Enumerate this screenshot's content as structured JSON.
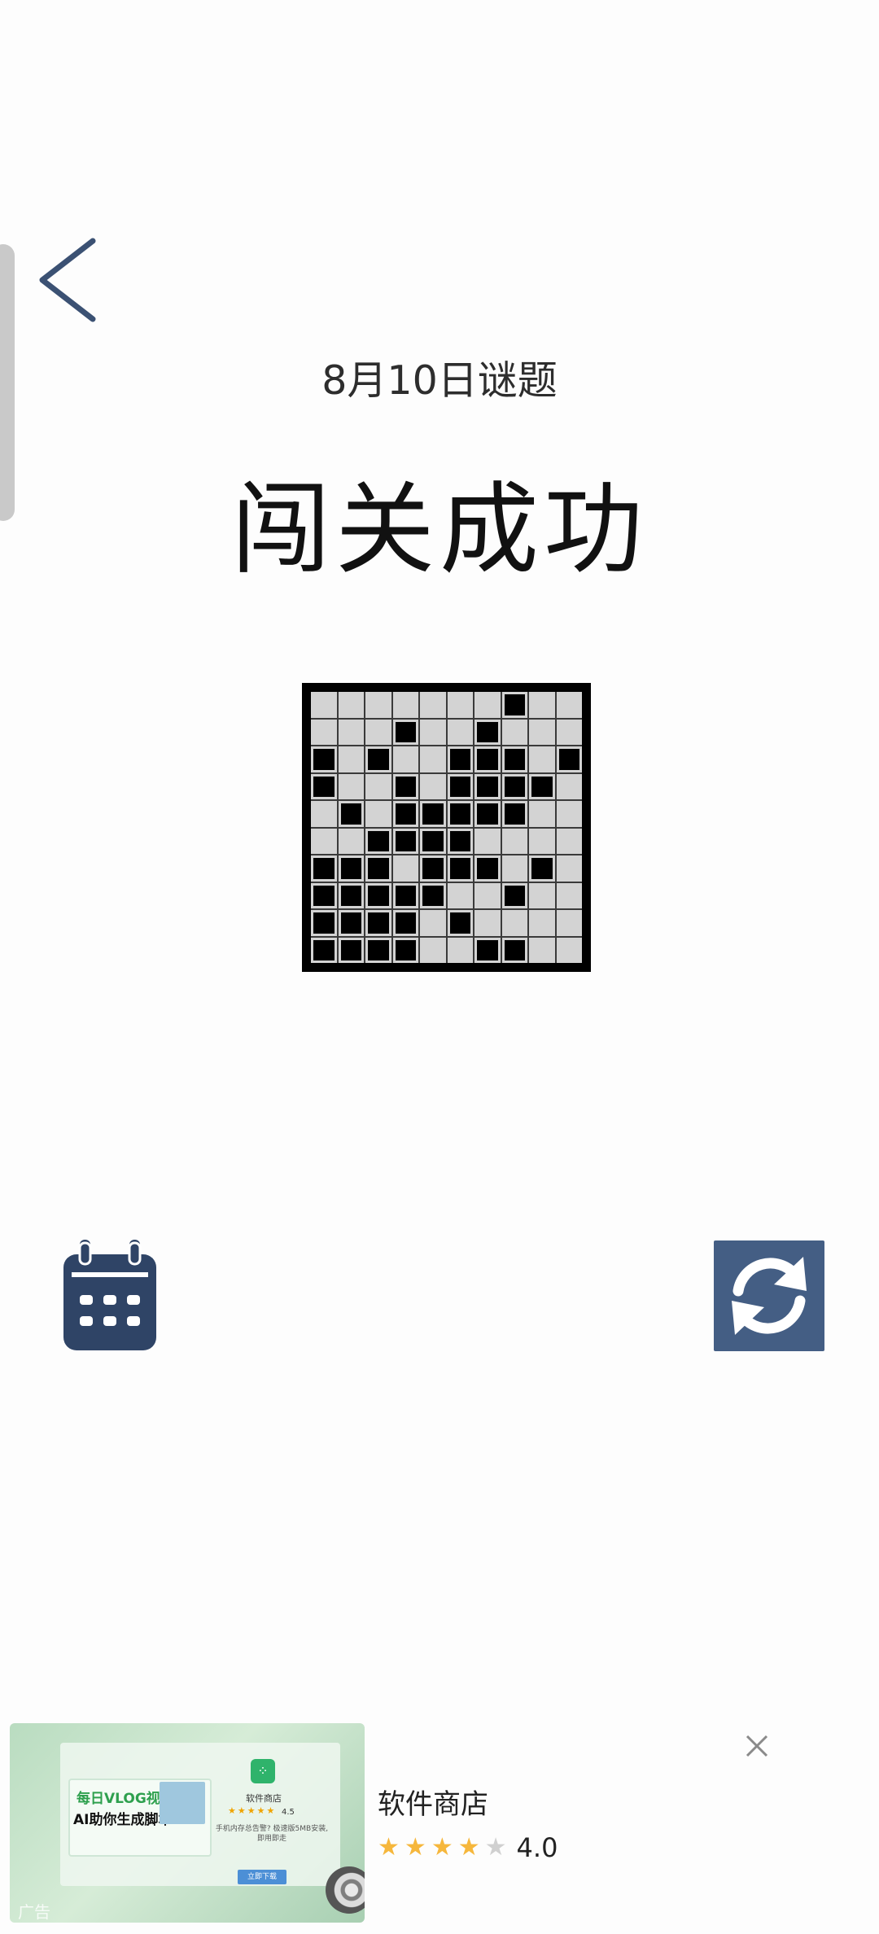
{
  "header": {
    "date_title": "8月10日谜题",
    "status_title": "闯关成功"
  },
  "board": {
    "rows": 10,
    "cols": 10,
    "filled": [
      [
        0,
        0,
        0,
        0,
        0,
        0,
        0,
        1,
        0,
        0
      ],
      [
        0,
        0,
        0,
        1,
        0,
        0,
        1,
        0,
        0,
        0
      ],
      [
        1,
        0,
        1,
        0,
        0,
        1,
        1,
        1,
        0,
        1
      ],
      [
        1,
        0,
        0,
        1,
        0,
        1,
        1,
        1,
        1,
        0
      ],
      [
        0,
        1,
        0,
        1,
        1,
        1,
        1,
        1,
        0,
        0
      ],
      [
        0,
        0,
        1,
        1,
        1,
        1,
        0,
        0,
        0,
        0
      ],
      [
        1,
        1,
        1,
        0,
        1,
        1,
        1,
        0,
        1,
        0
      ],
      [
        1,
        1,
        1,
        1,
        1,
        0,
        0,
        1,
        0,
        0
      ],
      [
        1,
        1,
        1,
        1,
        0,
        1,
        0,
        0,
        0,
        0
      ],
      [
        1,
        1,
        1,
        1,
        0,
        0,
        1,
        1,
        0,
        0
      ]
    ]
  },
  "controls": {
    "calendar_icon": "calendar-icon",
    "refresh_icon": "refresh-icon",
    "back_icon": "chevron-left-icon"
  },
  "ad": {
    "app_name": "软件商店",
    "rating": "4.0",
    "stars_filled": 4,
    "stars_total": 5,
    "close_icon": "close-icon",
    "image": {
      "headline_1": "每日VLOG视频",
      "headline_2": "AI助你生成脚本",
      "store_name": "软件商店",
      "mini_rating": "4.5",
      "description": "手机内存总告警? 极速版5MB安装, 即用即走",
      "download_label": "立即下载",
      "ad_label": "广告"
    }
  },
  "colors": {
    "refresh_bg": "#445e84",
    "calendar_fill": "#2f4466",
    "star_on": "#f6b73c",
    "star_off": "#d0d0d0"
  }
}
